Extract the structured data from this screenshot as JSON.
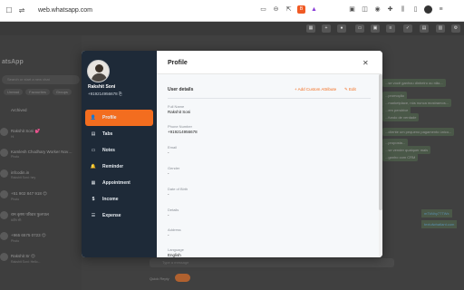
{
  "browser": {
    "url": "web.whatsapp.com",
    "brave_label": "B"
  },
  "whatsapp": {
    "title": "atsApp",
    "search_placeholder": "Search or start a new chat",
    "chips": [
      "Unread",
      "Favourites",
      "Groups"
    ],
    "archived_label": "Archived",
    "chats": [
      {
        "name": "Rakshit Soni 💕",
        "sub": "Hi"
      },
      {
        "name": "Kamlesh Chodhary Worker Nov…",
        "sub": "Photo"
      },
      {
        "name": "infcodin.in",
        "sub": "Rakshit Soni: hey"
      },
      {
        "name": "+51 902 847 918 😊",
        "sub": "Photo"
      },
      {
        "name": "राम कृष्ण परिवार फुलपाल",
        "sub": "प्रदीप सी:"
      },
      {
        "name": "+965 6575 0723 😊",
        "sub": "Photo"
      },
      {
        "name": "Rakshit Sr 😊",
        "sub": "Rakshit Soni: Hello..."
      }
    ],
    "bubbles": [
      "...se você ganhou dinheiro ou não...",
      "...promoção",
      "...marketplace, nós nunca mostramos...",
      "...em pendrive",
      "...fundo de verdade",
      "...cliente um pequeno pagamento único...",
      "...proposta...",
      "...se vender qualquer mais",
      "...ganho com CRM"
    ],
    "links": [
      "mTkNhy77TWx",
      "textufwhatlant.com"
    ],
    "message_placeholder": "Type a message",
    "quick_reply_label": "Quick Reply"
  },
  "modal": {
    "sidebar": {
      "name": "Rakshit Soni",
      "phone": "+919214956678",
      "nav": [
        {
          "label": "Profile",
          "icon": "person-icon",
          "glyph": "👤",
          "active": true
        },
        {
          "label": "Tabs",
          "icon": "tabs-icon",
          "glyph": "▤",
          "active": false
        },
        {
          "label": "Notes",
          "icon": "notes-icon",
          "glyph": "▭",
          "active": false
        },
        {
          "label": "Reminder",
          "icon": "bell-icon",
          "glyph": "🔔",
          "active": false
        },
        {
          "label": "Appointment",
          "icon": "calendar-icon",
          "glyph": "▦",
          "active": false
        },
        {
          "label": "Income",
          "icon": "dollar-icon",
          "glyph": "$",
          "active": false
        },
        {
          "label": "Expense",
          "icon": "list-icon",
          "glyph": "☰",
          "active": false
        }
      ]
    },
    "title": "Profile",
    "section_title": "User details",
    "add_attribute_label": "+ Add Custom Attribute",
    "edit_label": "Edit",
    "fields": [
      {
        "label": "Full Name",
        "value": "Rakshit Soni"
      },
      {
        "label": "Phone Number",
        "value": "+919214956678"
      },
      {
        "label": "Email",
        "value": "-"
      },
      {
        "label": "Gender",
        "value": "-"
      },
      {
        "label": "Date of Birth",
        "value": "-"
      },
      {
        "label": "Details",
        "value": "-"
      },
      {
        "label": "Address",
        "value": "-"
      },
      {
        "label": "Language",
        "value": "English"
      }
    ]
  }
}
